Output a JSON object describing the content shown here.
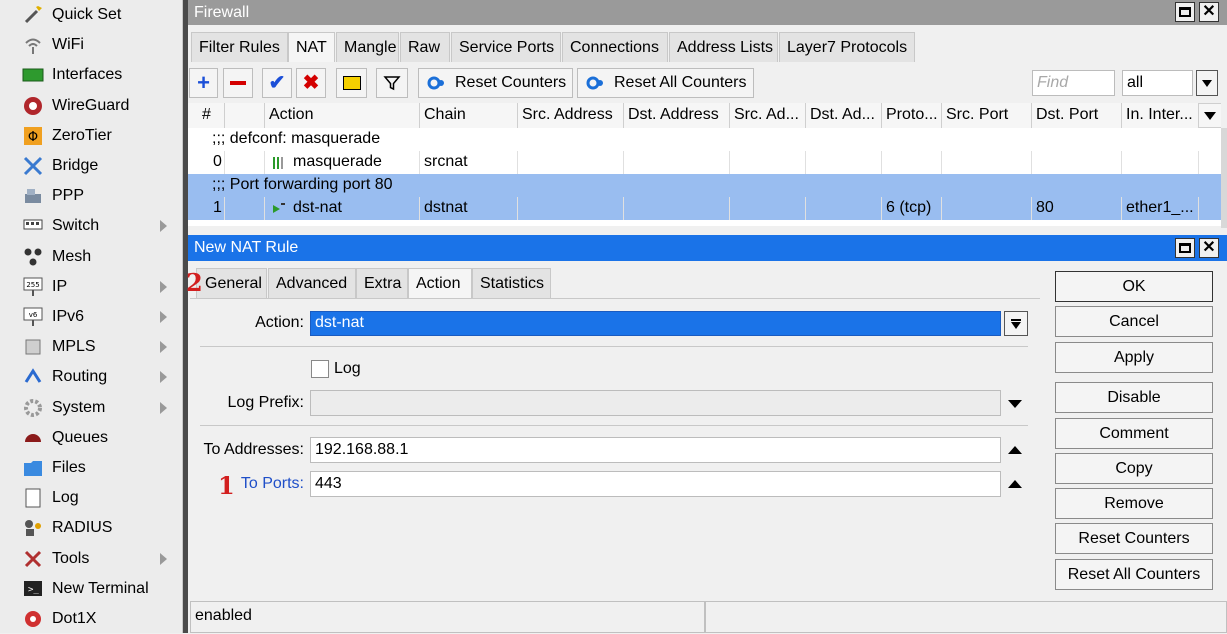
{
  "sidebar": {
    "items": [
      {
        "label": "Quick Set",
        "icon": "quick-set-icon"
      },
      {
        "label": "WiFi",
        "icon": "wifi-icon"
      },
      {
        "label": "Interfaces",
        "icon": "interfaces-icon"
      },
      {
        "label": "WireGuard",
        "icon": "wireguard-icon"
      },
      {
        "label": "ZeroTier",
        "icon": "zerotier-icon"
      },
      {
        "label": "Bridge",
        "icon": "bridge-icon"
      },
      {
        "label": "PPP",
        "icon": "ppp-icon"
      },
      {
        "label": "Switch",
        "icon": "switch-icon",
        "submenu": true
      },
      {
        "label": "Mesh",
        "icon": "mesh-icon"
      },
      {
        "label": "IP",
        "icon": "ip-icon",
        "submenu": true
      },
      {
        "label": "IPv6",
        "icon": "ipv6-icon",
        "submenu": true
      },
      {
        "label": "MPLS",
        "icon": "mpls-icon",
        "submenu": true
      },
      {
        "label": "Routing",
        "icon": "routing-icon",
        "submenu": true
      },
      {
        "label": "System",
        "icon": "system-icon",
        "submenu": true
      },
      {
        "label": "Queues",
        "icon": "queues-icon"
      },
      {
        "label": "Files",
        "icon": "files-icon"
      },
      {
        "label": "Log",
        "icon": "log-icon"
      },
      {
        "label": "RADIUS",
        "icon": "radius-icon"
      },
      {
        "label": "Tools",
        "icon": "tools-icon",
        "submenu": true
      },
      {
        "label": "New Terminal",
        "icon": "terminal-icon"
      },
      {
        "label": "Dot1X",
        "icon": "dot1x-icon"
      }
    ]
  },
  "firewall": {
    "title": "Firewall",
    "tabs": [
      "Filter Rules",
      "NAT",
      "Mangle",
      "Raw",
      "Service Ports",
      "Connections",
      "Address Lists",
      "Layer7 Protocols"
    ],
    "active_tab": "NAT",
    "toolbar": {
      "reset_counters": "Reset Counters",
      "reset_all_counters": "Reset All Counters",
      "find_placeholder": "Find",
      "filter_value": "all"
    },
    "columns": [
      "#",
      "Action",
      "Chain",
      "Src. Address",
      "Dst. Address",
      "Src. Ad...",
      "Dst. Ad...",
      "Proto...",
      "Src. Port",
      "Dst. Port",
      "In. Inter..."
    ],
    "comments": [
      ";;; defconf: masquerade",
      ";;; Port forwarding port 80"
    ],
    "rows": [
      {
        "num": "0",
        "action": "masquerade",
        "chain": "srcnat",
        "proto": "",
        "dst_port": "",
        "in_iface": ""
      },
      {
        "num": "1",
        "action": "dst-nat",
        "chain": "dstnat",
        "proto": "6 (tcp)",
        "dst_port": "80",
        "in_iface": "ether1_..."
      }
    ]
  },
  "dialog": {
    "title": "New NAT Rule",
    "tabs": [
      "General",
      "Advanced",
      "Extra",
      "Action",
      "Statistics"
    ],
    "active_tab": "Action",
    "fields": {
      "action_label": "Action:",
      "action_value": "dst-nat",
      "log_label": "Log",
      "log_prefix_label": "Log Prefix:",
      "log_prefix_value": "",
      "to_addresses_label": "To Addresses:",
      "to_addresses_value": "192.168.88.1",
      "to_ports_label": "To Ports:",
      "to_ports_value": "443"
    },
    "buttons": [
      "OK",
      "Cancel",
      "Apply",
      "Disable",
      "Comment",
      "Copy",
      "Remove",
      "Reset Counters",
      "Reset All Counters"
    ],
    "status": "enabled",
    "markers": {
      "general_tab": "2",
      "to_ports": "1"
    }
  },
  "colors": {
    "selection": "#99bdf0",
    "dialog_title": "#1a73e8",
    "marker": "#d21f1f",
    "link_label": "#1f4fc8"
  }
}
